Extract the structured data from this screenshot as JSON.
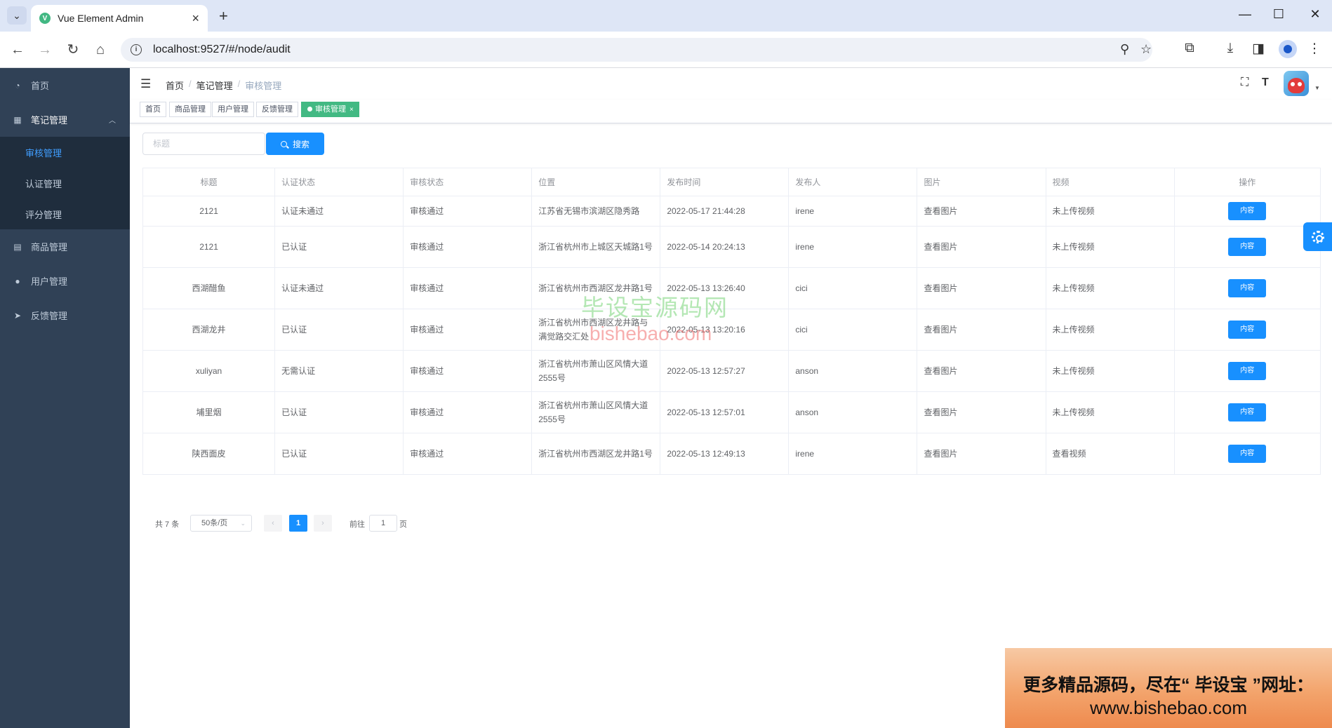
{
  "browser": {
    "tab_title": "Vue Element Admin",
    "url": "localhost:9527/#/node/audit"
  },
  "sidebar": {
    "items": [
      {
        "label": "首页",
        "icon": "dashboard-icon"
      },
      {
        "label": "笔记管理",
        "icon": "table-icon",
        "open": true,
        "children": [
          {
            "label": "审核管理",
            "active": true
          },
          {
            "label": "认证管理"
          },
          {
            "label": "评分管理"
          }
        ]
      },
      {
        "label": "商品管理",
        "icon": "document-icon"
      },
      {
        "label": "用户管理",
        "icon": "user-icon"
      },
      {
        "label": "反馈管理",
        "icon": "paper-plane-icon"
      }
    ]
  },
  "breadcrumb": [
    "首页",
    "笔记管理",
    "审核管理"
  ],
  "tags": [
    {
      "label": "首页"
    },
    {
      "label": "商品管理"
    },
    {
      "label": "用户管理"
    },
    {
      "label": "反馈管理"
    },
    {
      "label": "审核管理",
      "active": true
    }
  ],
  "filter": {
    "title_placeholder": "标题",
    "search_label": "搜索"
  },
  "table": {
    "columns": [
      "标题",
      "认证状态",
      "审核状态",
      "位置",
      "发布时间",
      "发布人",
      "图片",
      "视频",
      "操作"
    ],
    "rows": [
      {
        "title": "2121",
        "auth": "认证未通过",
        "audit": "审核通过",
        "location": "江苏省无锡市滨湖区隐秀路",
        "time": "2022-05-17 21:44:28",
        "author": "irene",
        "image": "查看图片",
        "video": "未上传视频",
        "action": "内容"
      },
      {
        "title": "2121",
        "auth": "已认证",
        "audit": "审核通过",
        "location": "浙江省杭州市上城区天城路1号",
        "time": "2022-05-14 20:24:13",
        "author": "irene",
        "image": "查看图片",
        "video": "未上传视频",
        "action": "内容"
      },
      {
        "title": "西湖醋鱼",
        "auth": "认证未通过",
        "audit": "审核通过",
        "location": "浙江省杭州市西湖区龙井路1号",
        "time": "2022-05-13 13:26:40",
        "author": "cici",
        "image": "查看图片",
        "video": "未上传视频",
        "action": "内容"
      },
      {
        "title": "西湖龙井",
        "auth": "已认证",
        "audit": "审核通过",
        "location": "浙江省杭州市西湖区龙井路与满觉路交汇处",
        "time": "2022-05-13 13:20:16",
        "author": "cici",
        "image": "查看图片",
        "video": "未上传视频",
        "action": "内容"
      },
      {
        "title": "xuliyan",
        "auth": "无需认证",
        "audit": "审核通过",
        "location": "浙江省杭州市萧山区风情大道2555号",
        "time": "2022-05-13 12:57:27",
        "author": "anson",
        "image": "查看图片",
        "video": "未上传视频",
        "action": "内容"
      },
      {
        "title": "埔里烟",
        "auth": "已认证",
        "audit": "审核通过",
        "location": "浙江省杭州市萧山区风情大道2555号",
        "time": "2022-05-13 12:57:01",
        "author": "anson",
        "image": "查看图片",
        "video": "未上传视频",
        "action": "内容"
      },
      {
        "title": "陕西面皮",
        "auth": "已认证",
        "audit": "审核通过",
        "location": "浙江省杭州市西湖区龙井路1号",
        "time": "2022-05-13 12:49:13",
        "author": "irene",
        "image": "查看图片",
        "video": "查看视频",
        "action": "内容"
      }
    ]
  },
  "pagination": {
    "total_text": "共 7 条",
    "page_size": "50条/页",
    "current_page": "1",
    "goto_label": "前往",
    "goto_value": "1",
    "page_suffix": "页"
  },
  "watermark": {
    "cn": "毕设宝源码网",
    "en": "bishebao.com",
    "banner_line1": "更多精品源码，尽在“ 毕设宝 ”网址：",
    "banner_line2": "www.bishebao.com"
  }
}
